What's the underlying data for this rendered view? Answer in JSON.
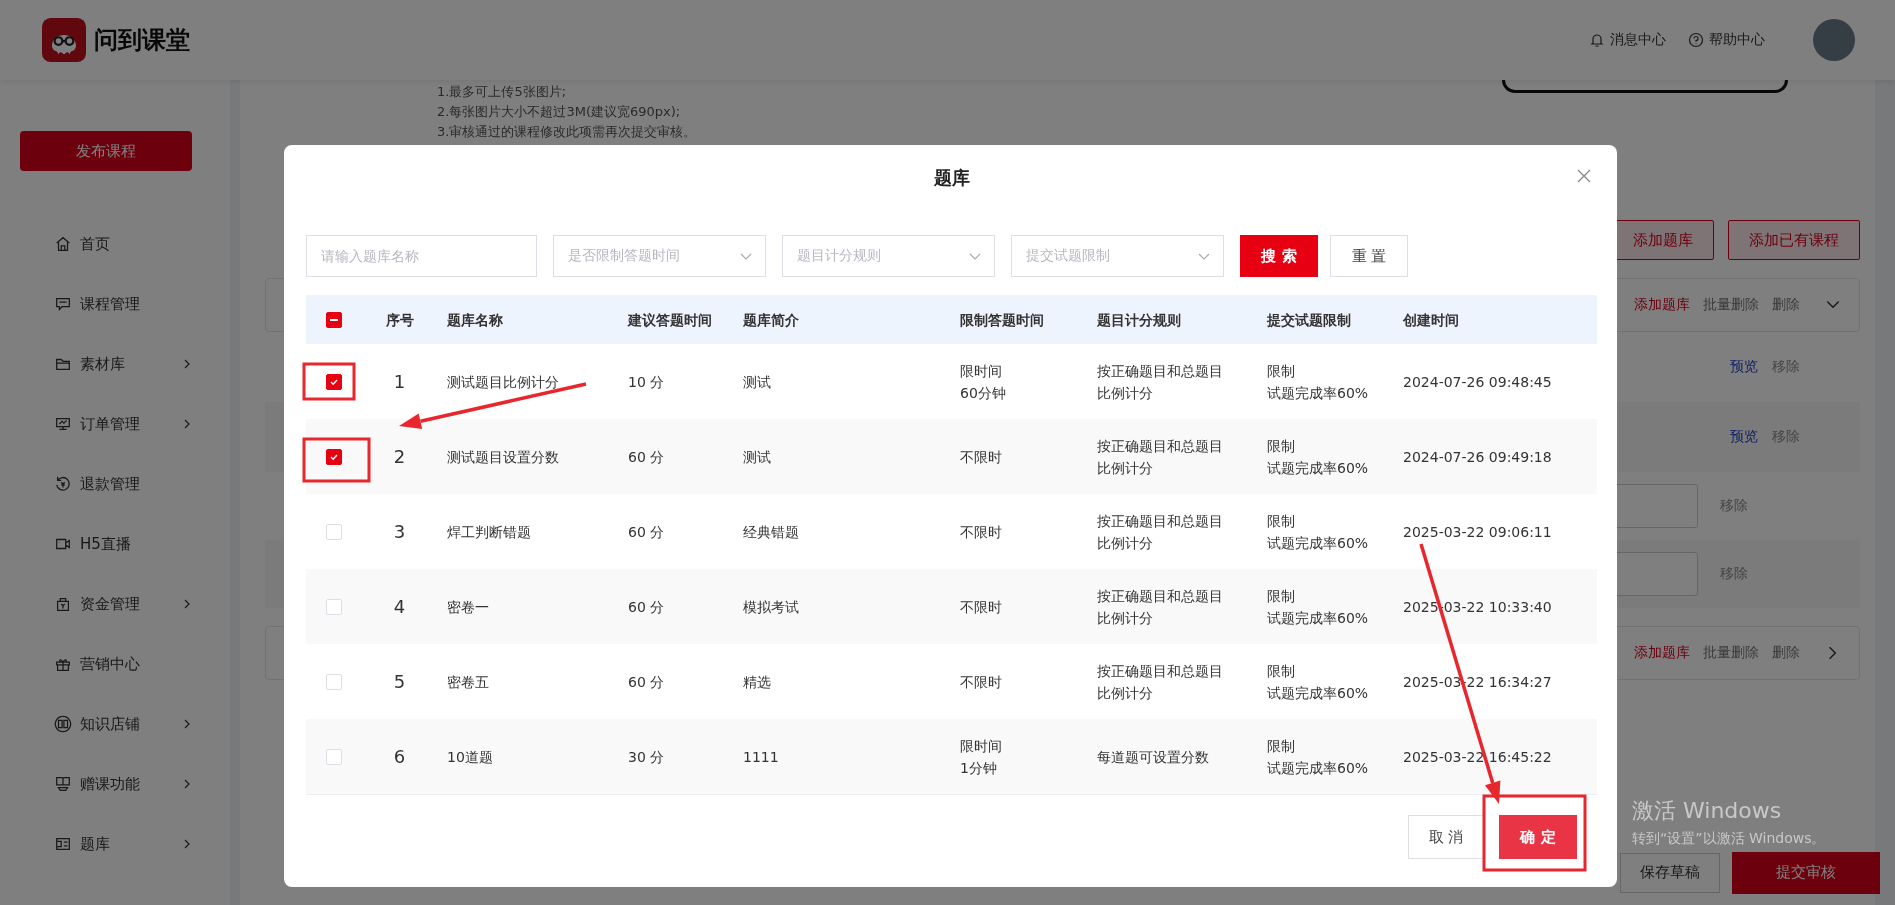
{
  "header": {
    "brand": "问到课堂",
    "links": [
      {
        "kind": "bell",
        "label": "消息中心"
      },
      {
        "kind": "help",
        "label": "帮助中心"
      }
    ]
  },
  "sidebar": {
    "publish_button": "发布课程",
    "items": [
      {
        "kind": "home",
        "label": "首页",
        "expandable": false
      },
      {
        "kind": "message",
        "label": "课程管理",
        "expandable": false
      },
      {
        "kind": "folder",
        "label": "素材库",
        "expandable": true
      },
      {
        "kind": "monitor",
        "label": "订单管理",
        "expandable": true
      },
      {
        "kind": "refund",
        "label": "退款管理",
        "expandable": false
      },
      {
        "kind": "video",
        "label": "H5直播",
        "expandable": false
      },
      {
        "kind": "purse",
        "label": "资金管理",
        "expandable": true
      },
      {
        "kind": "gift",
        "label": "营销中心",
        "expandable": false
      },
      {
        "kind": "book",
        "label": "知识店铺",
        "expandable": true
      },
      {
        "kind": "stand",
        "label": "赠课功能",
        "expandable": true
      },
      {
        "kind": "list",
        "label": "题库",
        "expandable": true
      }
    ]
  },
  "page": {
    "upload_notes": [
      "1.最多可上传5张图片;",
      "2.每张图片大小不超过3M(建议宽690px);",
      "3.审核通过的课程修改此项需再次提交审核。"
    ],
    "actions": [
      "添加题库",
      "添加已有课程"
    ],
    "sections": [
      {
        "expanded": true,
        "actions": [
          "添加题库",
          "批量删除",
          "删除"
        ],
        "items": [
          {
            "kind": "preview",
            "preview": "预览",
            "remove": "移除"
          },
          {
            "kind": "preview",
            "preview": "预览",
            "remove": "移除"
          },
          {
            "kind": "input",
            "remove": "移除"
          },
          {
            "kind": "input",
            "remove": "移除"
          }
        ]
      },
      {
        "expanded": false,
        "actions": [
          "添加题库",
          "批量删除",
          "删除"
        ]
      }
    ],
    "footer": {
      "draft": "保存草稿",
      "submit": "提交审核"
    }
  },
  "modal": {
    "title": "题库",
    "filters": {
      "name_placeholder": "请输入题库名称",
      "selects": [
        "是否限制答题时间",
        "题目计分规则",
        "提交试题限制"
      ],
      "search": "搜 索",
      "reset": "重 置"
    },
    "table": {
      "select_all": {
        "indeterminate": true
      },
      "columns": [
        "序号",
        "题库名称",
        "建议答题时间",
        "题库简介",
        "限制答题时间",
        "题目计分规则",
        "提交试题限制",
        "创建时间"
      ],
      "rows": [
        {
          "selected": true,
          "index": "1",
          "name": "测试题目比例计分",
          "suggested": "10 分",
          "intro": "测试",
          "limit": [
            "限时间",
            "60分钟"
          ],
          "rule": [
            "按正确题目和总题目",
            "比例计分"
          ],
          "submit": [
            "限制",
            "试题完成率60%"
          ],
          "created": "2024-07-26 09:48:45"
        },
        {
          "selected": true,
          "index": "2",
          "name": "测试题目设置分数",
          "suggested": "60 分",
          "intro": "测试",
          "limit": [
            "不限时"
          ],
          "rule": [
            "按正确题目和总题目",
            "比例计分"
          ],
          "submit": [
            "限制",
            "试题完成率60%"
          ],
          "created": "2024-07-26 09:49:18"
        },
        {
          "selected": false,
          "index": "3",
          "name": "焊工判断错题",
          "suggested": "60 分",
          "intro": "经典错题",
          "limit": [
            "不限时"
          ],
          "rule": [
            "按正确题目和总题目",
            "比例计分"
          ],
          "submit": [
            "限制",
            "试题完成率60%"
          ],
          "created": "2025-03-22 09:06:11"
        },
        {
          "selected": false,
          "index": "4",
          "name": "密卷一",
          "suggested": "60 分",
          "intro": "模拟考试",
          "limit": [
            "不限时"
          ],
          "rule": [
            "按正确题目和总题目",
            "比例计分"
          ],
          "submit": [
            "限制",
            "试题完成率60%"
          ],
          "created": "2025-03-22 10:33:40"
        },
        {
          "selected": false,
          "index": "5",
          "name": "密卷五",
          "suggested": "60 分",
          "intro": "精选",
          "limit": [
            "不限时"
          ],
          "rule": [
            "按正确题目和总题目",
            "比例计分"
          ],
          "submit": [
            "限制",
            "试题完成率60%"
          ],
          "created": "2025-03-22 16:34:27"
        },
        {
          "selected": false,
          "index": "6",
          "name": "10道题",
          "suggested": "30 分",
          "intro": "1111",
          "limit": [
            "限时间",
            "1分钟"
          ],
          "rule": [
            "每道题可设置分数"
          ],
          "submit": [
            "限制",
            "试题完成率60%"
          ],
          "created": "2025-03-22 16:45:22"
        }
      ]
    },
    "buttons": {
      "cancel": "取 消",
      "confirm": "确 定"
    }
  },
  "os_notice": {
    "title": "激活 Windows",
    "subtitle": "转到“设置”以激活 Windows。"
  }
}
